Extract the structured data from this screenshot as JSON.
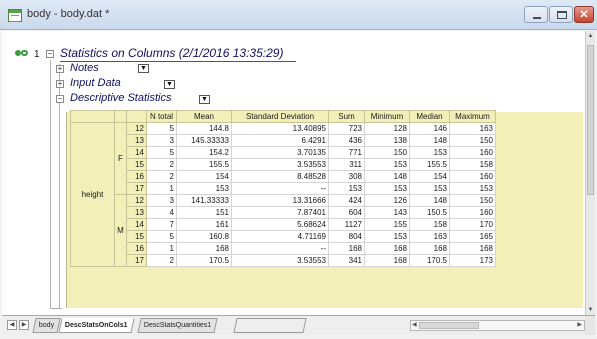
{
  "window": {
    "title": "body - body.dat *"
  },
  "tree": {
    "node_number": "1",
    "report_title": "Statistics on Columns (2/1/2016 13:35:29)",
    "children": [
      {
        "label": "Notes",
        "expanded": false
      },
      {
        "label": "Input Data",
        "expanded": false
      },
      {
        "label": "Descriptive Statistics",
        "expanded": true
      }
    ]
  },
  "table": {
    "columns": [
      "N total",
      "Mean",
      "Standard Deviation",
      "Sum",
      "Minimum",
      "Median",
      "Maximum"
    ],
    "variable": "height",
    "groups": [
      {
        "name": "F",
        "rows": [
          {
            "idx": "12",
            "values": [
              "5",
              "144.8",
              "13.40895",
              "723",
              "128",
              "146",
              "163"
            ]
          },
          {
            "idx": "13",
            "values": [
              "3",
              "145.33333",
              "6.4291",
              "436",
              "138",
              "148",
              "150"
            ]
          },
          {
            "idx": "14",
            "values": [
              "5",
              "154.2",
              "3.70135",
              "771",
              "150",
              "153",
              "160"
            ]
          },
          {
            "idx": "15",
            "values": [
              "2",
              "155.5",
              "3.53553",
              "311",
              "153",
              "155.5",
              "158"
            ]
          },
          {
            "idx": "16",
            "values": [
              "2",
              "154",
              "8.48528",
              "308",
              "148",
              "154",
              "160"
            ]
          },
          {
            "idx": "17",
            "values": [
              "1",
              "153",
              "--",
              "153",
              "153",
              "153",
              "153"
            ]
          }
        ]
      },
      {
        "name": "M",
        "rows": [
          {
            "idx": "12",
            "values": [
              "3",
              "141.33333",
              "13.31666",
              "424",
              "126",
              "148",
              "150"
            ]
          },
          {
            "idx": "13",
            "values": [
              "4",
              "151",
              "7.87401",
              "604",
              "143",
              "150.5",
              "160"
            ]
          },
          {
            "idx": "14",
            "values": [
              "7",
              "161",
              "5.68624",
              "1127",
              "155",
              "158",
              "170"
            ]
          },
          {
            "idx": "15",
            "values": [
              "5",
              "160.8",
              "4.71169",
              "804",
              "153",
              "163",
              "165"
            ]
          },
          {
            "idx": "16",
            "values": [
              "1",
              "168",
              "--",
              "168",
              "168",
              "168",
              "168"
            ]
          },
          {
            "idx": "17",
            "values": [
              "2",
              "170.5",
              "3.53553",
              "341",
              "168",
              "170.5",
              "173"
            ]
          }
        ]
      }
    ]
  },
  "tabs": [
    "body",
    "DescStatsOnCols1",
    "DescStatsQuantities1"
  ],
  "active_tab": "DescStatsOnCols1",
  "colors": {
    "header_fill": "#f2f0b8",
    "link_icon": "#3e9a46"
  },
  "icons": [
    "app-workbook-icon",
    "minimize-icon",
    "maximize-icon",
    "close-icon",
    "link-icon",
    "expand-box-icon",
    "collapse-box-icon",
    "dropdown-arrow-icon",
    "scroll-arrow-icon"
  ]
}
